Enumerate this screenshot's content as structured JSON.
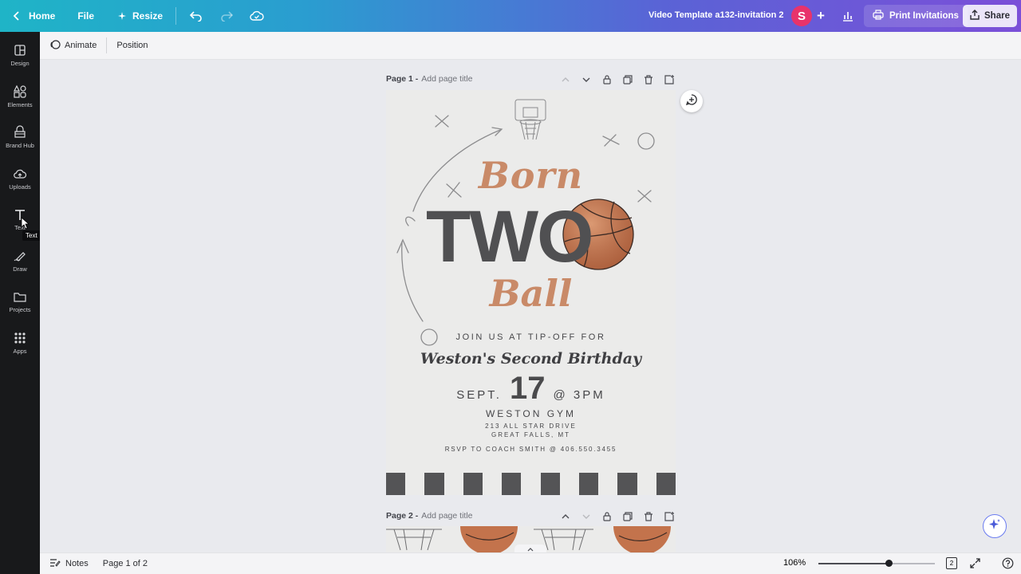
{
  "topbar": {
    "home_label": "Home",
    "file_label": "File",
    "resize_label": "Resize",
    "doc_title": "Video Template a132-invitation 2",
    "avatar_initial": "S",
    "print_label": "Print Invitations",
    "share_label": "Share"
  },
  "sidebar": {
    "items": [
      {
        "label": "Design",
        "icon": "design-icon"
      },
      {
        "label": "Elements",
        "icon": "elements-icon"
      },
      {
        "label": "Brand Hub",
        "icon": "brand-hub-icon"
      },
      {
        "label": "Uploads",
        "icon": "upload-cloud-icon"
      },
      {
        "label": "Text",
        "icon": "text-icon"
      },
      {
        "label": "Draw",
        "icon": "draw-icon"
      },
      {
        "label": "Projects",
        "icon": "folder-icon"
      },
      {
        "label": "Apps",
        "icon": "apps-grid-icon"
      }
    ],
    "tooltip": "Text"
  },
  "subbar": {
    "animate_label": "Animate",
    "position_label": "Position"
  },
  "pages": [
    {
      "title": "Page 1 -",
      "placeholder": "Add page title"
    },
    {
      "title": "Page 2 -",
      "placeholder": "Add page title"
    }
  ],
  "invitation": {
    "born": "Born",
    "two": "TWO",
    "ball": "Ball",
    "join_us": "JOIN US AT TIP-OFF FOR",
    "name_line": "Weston's Second Birthday",
    "date_month": "SEPT.",
    "date_day": "17",
    "date_time": "@ 3PM",
    "venue": "WESTON GYM",
    "address_1": "213 ALL STAR DRIVE",
    "address_2": "GREAT FALLS, MT",
    "rsvp": "RSVP TO COACH SMITH @ 406.550.3455",
    "colors": {
      "accent": "#c98a68",
      "dark": "#505052",
      "paper": "#ebebea"
    }
  },
  "bottombar": {
    "notes_label": "Notes",
    "page_indicator": "Page 1 of 2",
    "zoom_label": "106%",
    "zoom_level": 0.6,
    "page_count_badge": "2"
  }
}
